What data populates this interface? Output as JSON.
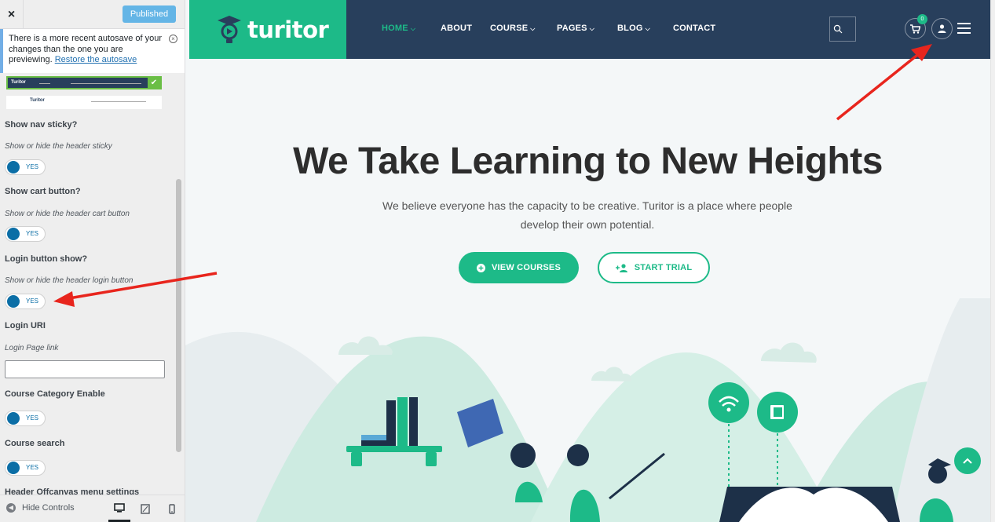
{
  "customizer": {
    "close_label": "×",
    "publish_label": "Published",
    "autosave_notice": {
      "text": "There is a more recent autosave of your changes than the one you are previewing.",
      "link": "Restore the autosave",
      "close": "×"
    },
    "header_thumbs": [
      {
        "logo": "Turitor",
        "selected": true
      },
      {
        "logo": "Turitor",
        "selected": false
      }
    ],
    "controls": [
      {
        "title": "Show nav sticky?",
        "desc": "Show or hide the header sticky",
        "toggle": "YES"
      },
      {
        "title": "Show cart button?",
        "desc": "Show or hide the header cart button",
        "toggle": "YES"
      },
      {
        "title": "Login button show?",
        "desc": "Show or hide the header login button",
        "toggle": "YES"
      },
      {
        "title": "Login URI",
        "desc": "Login Page link",
        "input_value": ""
      },
      {
        "title": "Course Category Enable",
        "toggle": "YES"
      },
      {
        "title": "Course search",
        "toggle": "YES"
      },
      {
        "title": "Header Offcanvas menu settings"
      }
    ],
    "footer": {
      "hide_label": "Hide Controls",
      "devices": [
        "desktop-icon",
        "tablet-icon",
        "mobile-icon"
      ]
    }
  },
  "site": {
    "logo": "turitor",
    "nav": [
      {
        "label": "HOME",
        "dropdown": true,
        "active": true
      },
      {
        "label": "ABOUT",
        "dropdown": false,
        "active": false
      },
      {
        "label": "COURSE",
        "dropdown": true,
        "active": false
      },
      {
        "label": "PAGES",
        "dropdown": true,
        "active": false
      },
      {
        "label": "BLOG",
        "dropdown": true,
        "active": false
      },
      {
        "label": "CONTACT",
        "dropdown": false,
        "active": false
      }
    ],
    "cart_count": "0",
    "hero": {
      "title": "We Take Learning to New Heights",
      "subtitle": "We believe everyone has the capacity to be creative. Turitor is a place where people develop their own potential.",
      "btn_primary": "VIEW COURSES",
      "btn_secondary": "START TRIAL"
    }
  },
  "colors": {
    "brand_green": "#1dba88",
    "nav_navy": "#283f5c",
    "toggle_blue": "#0b6ea6",
    "annotation_red": "#e8251d"
  }
}
